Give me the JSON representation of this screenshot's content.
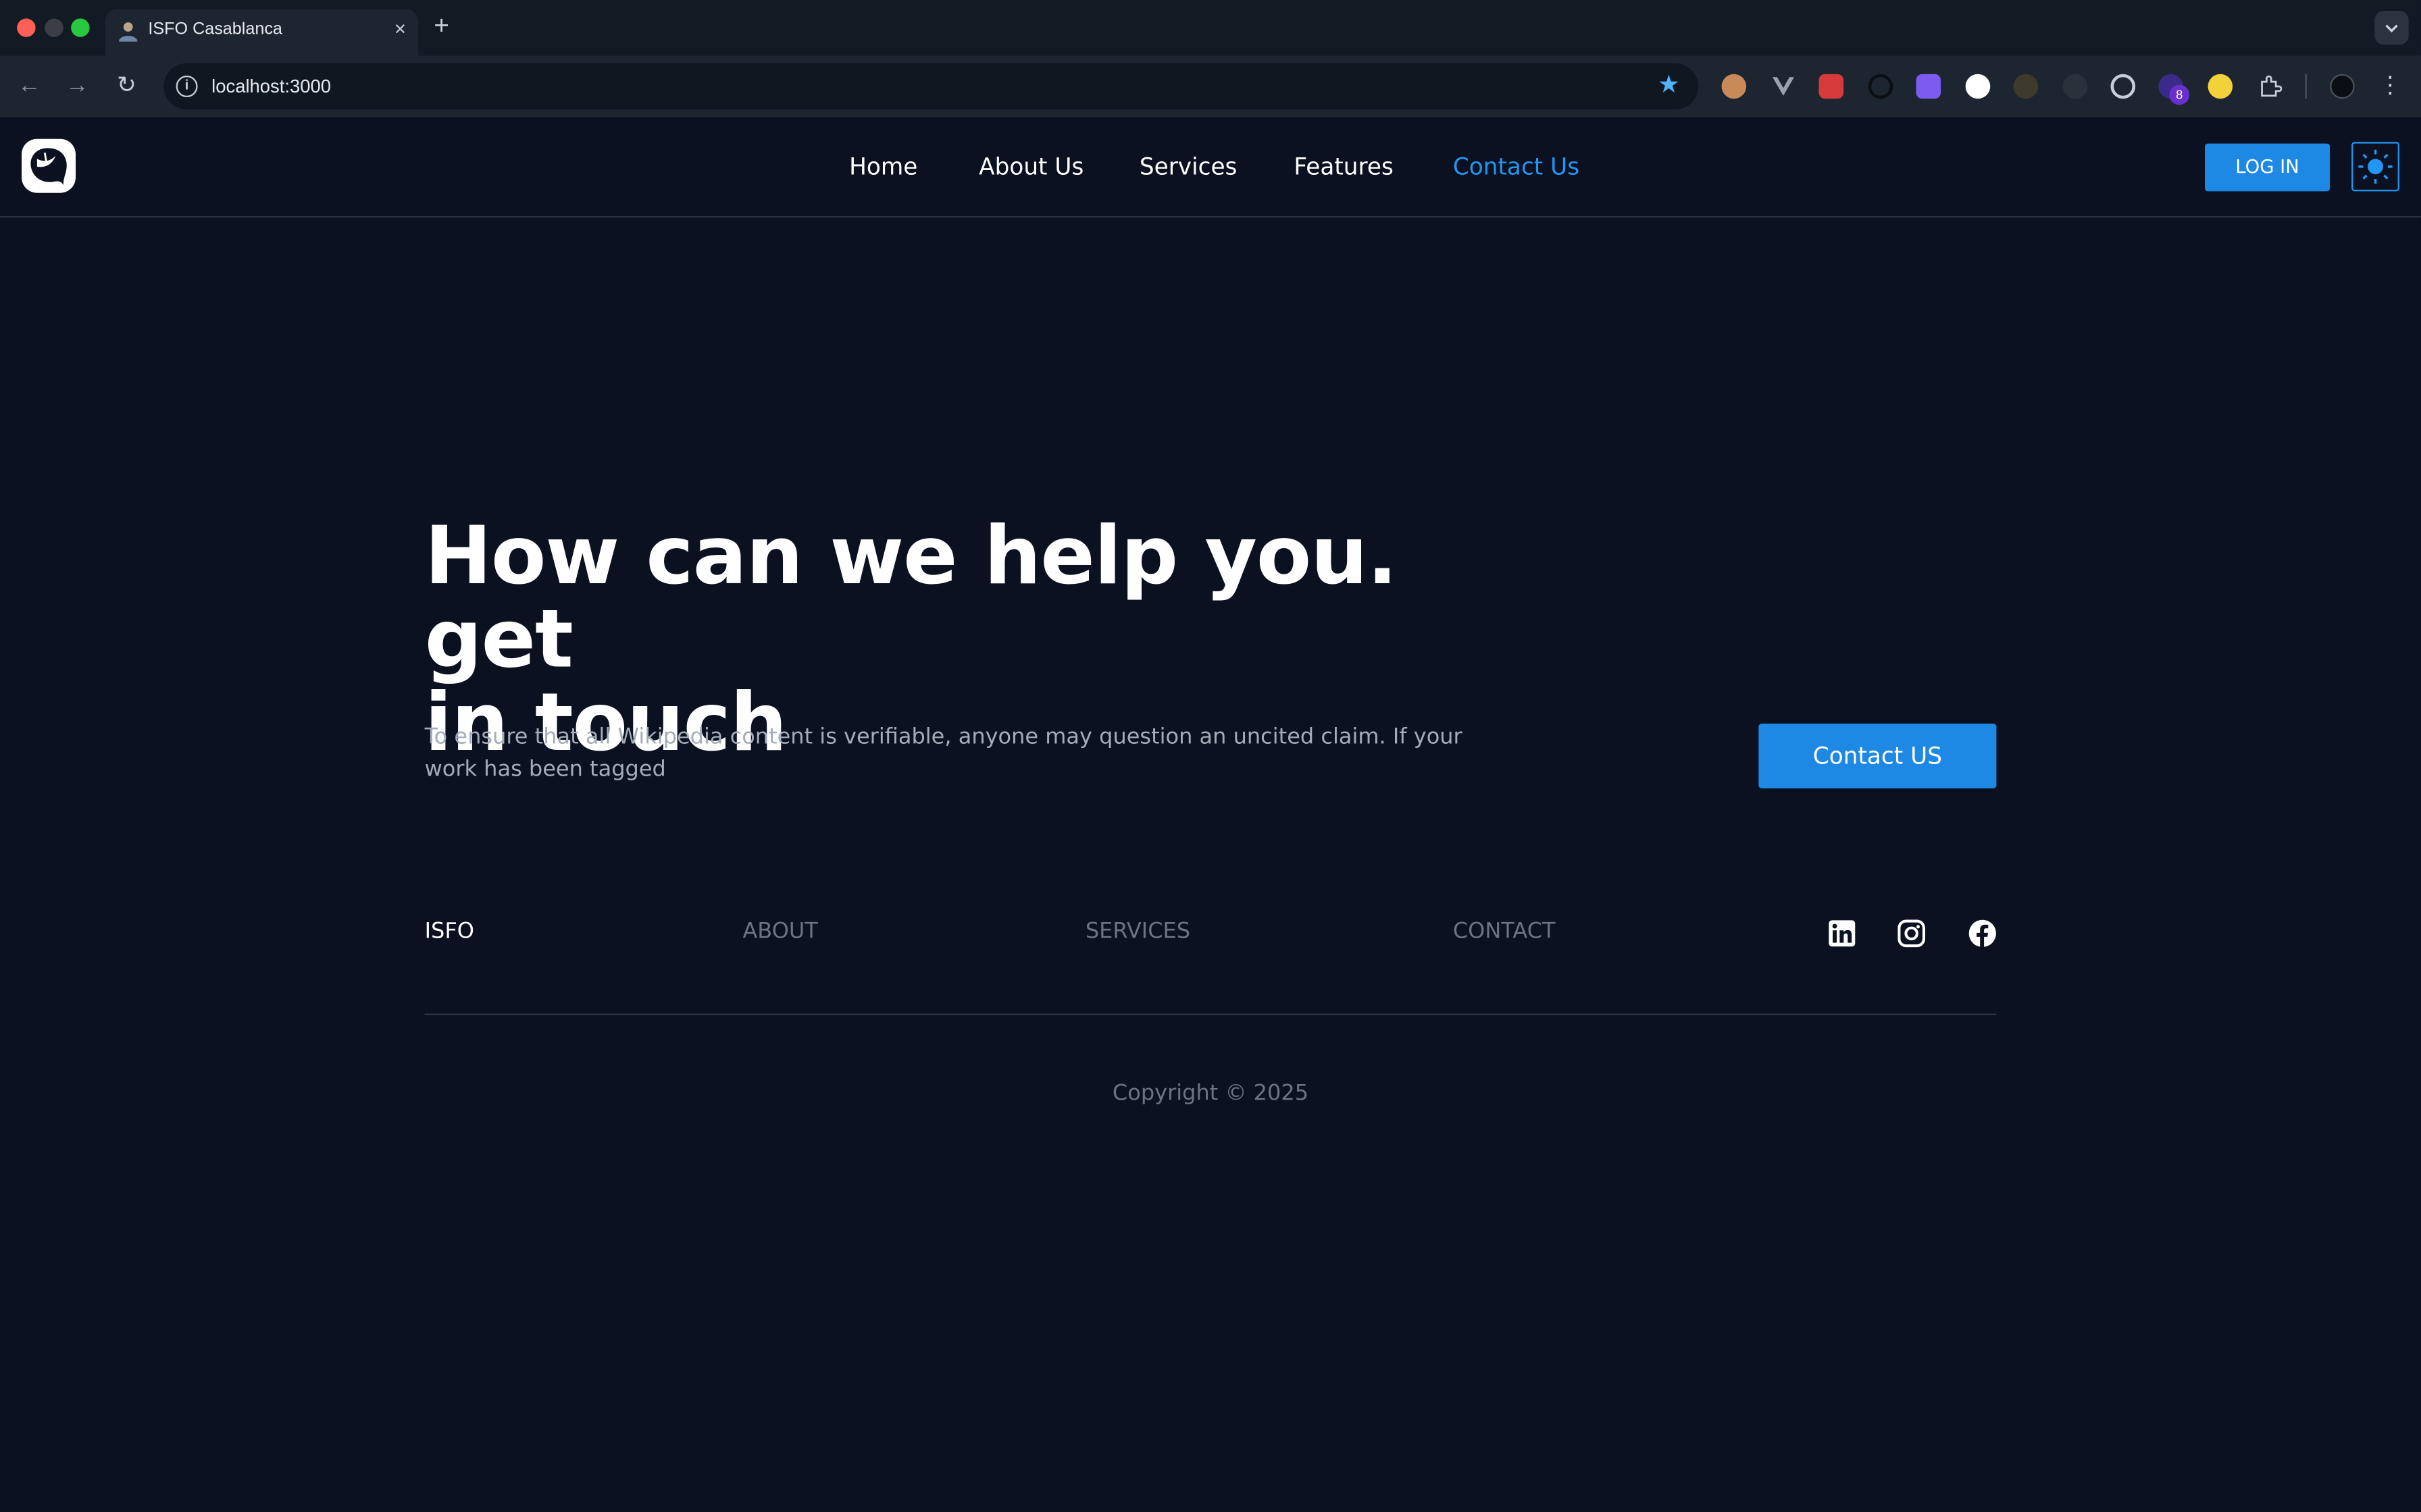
{
  "browser": {
    "tab_title": "ISFO Casablanca",
    "tab_close": "×",
    "new_tab": "+",
    "url": "localhost:3000",
    "extension_badge": "8"
  },
  "header": {
    "logo_icon": "isfo-bird-logo",
    "nav": [
      {
        "label": "Home"
      },
      {
        "label": "About Us"
      },
      {
        "label": "Services"
      },
      {
        "label": "Features"
      },
      {
        "label": "Contact Us",
        "active": true
      }
    ],
    "login_label": "LOG IN",
    "theme_icon": "sun-icon"
  },
  "hero": {
    "title_line1": "How can we help you. get",
    "title_line2": "in touch",
    "text": "To ensure that all Wikipedia content is verifiable, anyone may question an uncited claim. If your work has been tagged",
    "cta_label": "Contact US"
  },
  "footer": {
    "brand": "ISFO",
    "links": [
      "ABOUT",
      "SERVICES",
      "CONTACT"
    ],
    "socials": [
      "linkedin-icon",
      "instagram-icon",
      "facebook-icon"
    ],
    "copyright": "Copyright © 2025"
  },
  "colors": {
    "background": "#0b1120",
    "accent": "#1e88e5",
    "active_link": "#2196f3",
    "muted_text": "#6b7484"
  }
}
